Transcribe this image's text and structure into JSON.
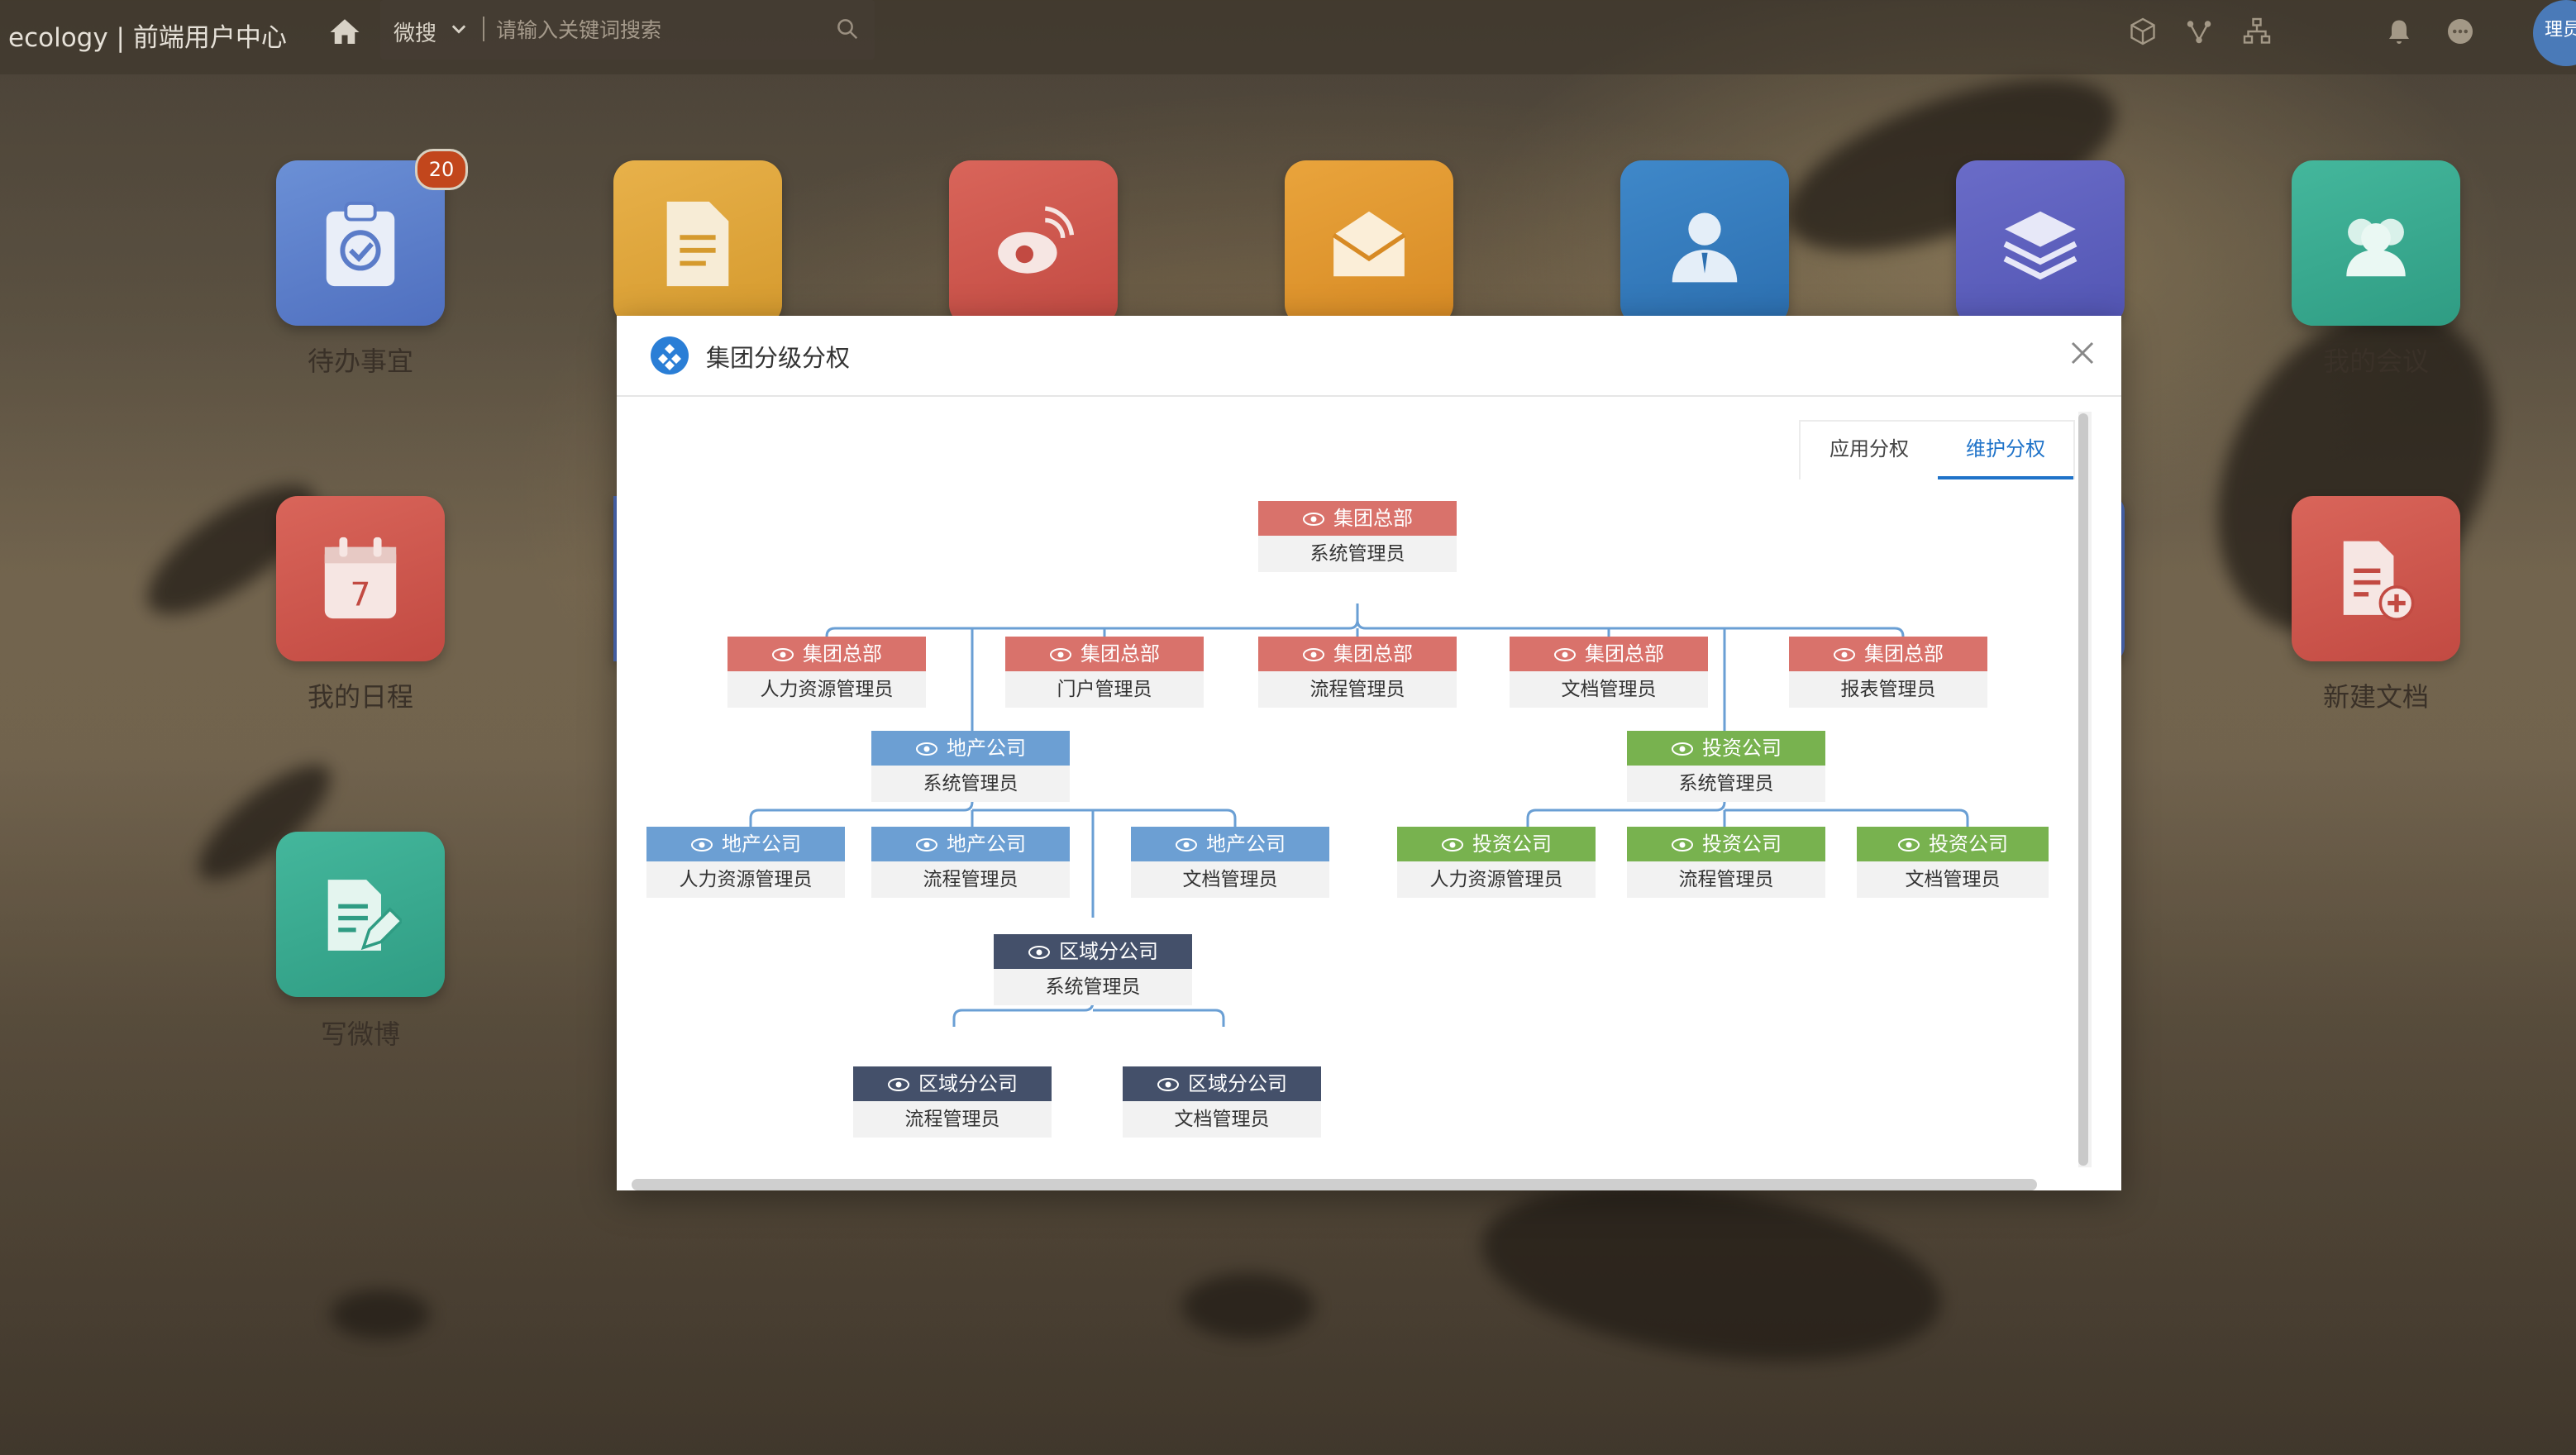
{
  "topbar": {
    "brand": "ecology | 前端用户中心",
    "search_scope": "微搜",
    "search_placeholder": "请输入关键词搜索",
    "user_label": "理员"
  },
  "desktop": {
    "todo_badge": "20",
    "tiles": [
      {
        "label": "待办事宜"
      },
      {
        "label": "我的会议"
      },
      {
        "label": "我的日程"
      },
      {
        "label": "新建文档"
      },
      {
        "label": "写微博"
      }
    ]
  },
  "modal": {
    "title": "集团分级分权",
    "tabs": [
      "应用分权",
      "维护分权"
    ],
    "active_tab": "维护分权"
  },
  "org": {
    "root": {
      "unit": "集团总部",
      "role": "系统管理员"
    },
    "hq_children": [
      {
        "unit": "集团总部",
        "role": "人力资源管理员"
      },
      {
        "unit": "集团总部",
        "role": "门户管理员"
      },
      {
        "unit": "集团总部",
        "role": "流程管理员"
      },
      {
        "unit": "集团总部",
        "role": "文档管理员"
      },
      {
        "unit": "集团总部",
        "role": "报表管理员"
      }
    ],
    "realestate": {
      "unit": "地产公司",
      "role": "系统管理员"
    },
    "realestate_children": [
      {
        "unit": "地产公司",
        "role": "人力资源管理员"
      },
      {
        "unit": "地产公司",
        "role": "流程管理员"
      },
      {
        "unit": "地产公司",
        "role": "文档管理员"
      }
    ],
    "investment": {
      "unit": "投资公司",
      "role": "系统管理员"
    },
    "investment_children": [
      {
        "unit": "投资公司",
        "role": "人力资源管理员"
      },
      {
        "unit": "投资公司",
        "role": "流程管理员"
      },
      {
        "unit": "投资公司",
        "role": "文档管理员"
      }
    ],
    "regional": {
      "unit": "区域分公司",
      "role": "系统管理员"
    },
    "regional_children": [
      {
        "unit": "区域分公司",
        "role": "流程管理员"
      },
      {
        "unit": "区域分公司",
        "role": "文档管理员"
      }
    ]
  },
  "colors": {
    "hq": "#d9726b",
    "realestate": "#6c9fd3",
    "investment": "#78b24f",
    "regional": "#44506a",
    "connector": "#6a9fd4",
    "accent": "#1f73c9"
  }
}
